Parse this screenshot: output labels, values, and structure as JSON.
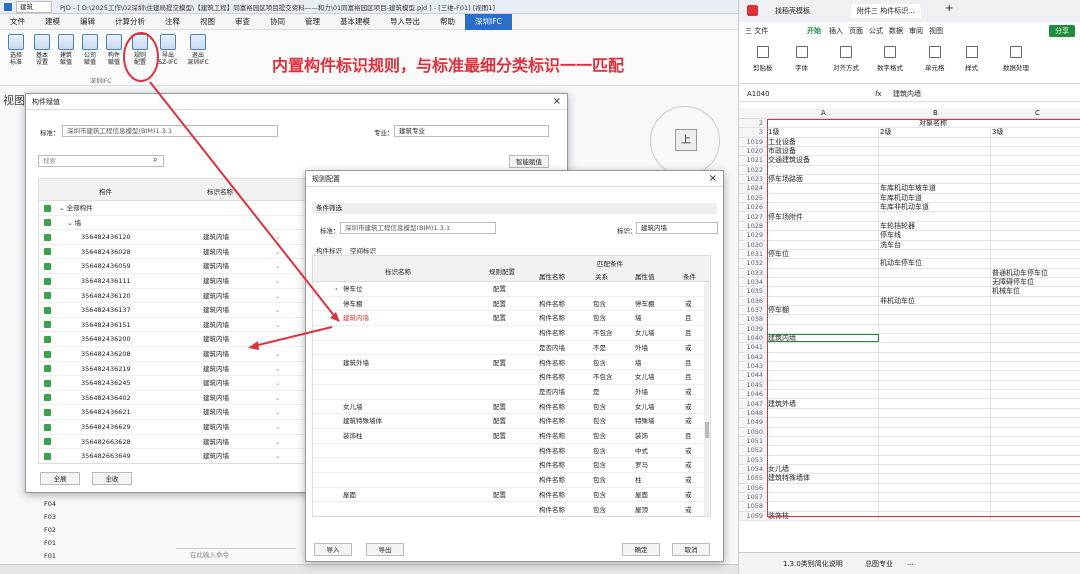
{
  "left_app": {
    "title": "PJD - [ D:\\2025工作\\02深圳\\住建局提交模型\\【建筑工程】同富裕园区项目提交资料——和力\\01同富裕园区项目-建筑模型.pjd ] - [三维-F01] [视图1]",
    "view_selector": "建筑",
    "menu": [
      "文件",
      "建模",
      "编辑",
      "计算分析",
      "注释",
      "视图",
      "审查",
      "协同",
      "管理",
      "基本建模",
      "导入导出",
      "帮助",
      "深圳IFC"
    ],
    "ribbon_buttons": [
      "选择\n标准",
      "基本\n设置",
      "建筑\n赋值",
      "公司\n赋值",
      "构件\n赋值",
      "规则\n配置",
      "导出\nSZ-IFC",
      "退出\n深圳IFC"
    ],
    "ribbon_group": "深圳IFC",
    "headline": "内置构件标识规则，与标准最细分类标识一一匹配",
    "view_label": "视图",
    "compass_label": "上",
    "floors": [
      "F04",
      "F03",
      "F02",
      "F01",
      "F01"
    ],
    "command_hint": "在此输入命令"
  },
  "dlg1": {
    "title": "构件赋值",
    "standard_label": "标准：",
    "standard_value": "深圳市建筑工程信息模型(BIM)1.3.1",
    "major_label": "专业：",
    "major_value": "建筑专业",
    "search_placeholder": "搜索",
    "smart_button": "智能赋值",
    "col_component": "构件",
    "col_identifier": "标识名称",
    "tree_all": "全部构件",
    "tree_wall": "墙",
    "rows": [
      {
        "id": "356482436120",
        "name": "建筑内墙"
      },
      {
        "id": "356482436028",
        "name": "建筑内墙"
      },
      {
        "id": "356482436059",
        "name": "建筑内墙"
      },
      {
        "id": "356482436111",
        "name": "建筑内墙"
      },
      {
        "id": "356482436120",
        "name": "建筑内墙"
      },
      {
        "id": "356482436137",
        "name": "建筑内墙"
      },
      {
        "id": "356482436151",
        "name": "建筑内墙"
      },
      {
        "id": "356482436200",
        "name": "建筑内墙"
      },
      {
        "id": "356482436208",
        "name": "建筑内墙"
      },
      {
        "id": "356482436219",
        "name": "建筑内墙"
      },
      {
        "id": "356482436245",
        "name": "建筑内墙"
      },
      {
        "id": "356482436402",
        "name": "建筑内墙"
      },
      {
        "id": "356482436621",
        "name": "建筑内墙"
      },
      {
        "id": "356482436629",
        "name": "建筑内墙"
      },
      {
        "id": "356482663628",
        "name": "建筑内墙"
      },
      {
        "id": "356482663649",
        "name": "建筑内墙"
      }
    ],
    "btn_all": "全展",
    "btn_collapse": "全收"
  },
  "dlg2": {
    "title": "规则配置",
    "filter_label": "条件筛选",
    "standard_label": "标准：",
    "standard_value": "深圳市建筑工程信息模型(BIM)1.3.1",
    "ident_label": "标识：",
    "ident_value": "建筑内墙",
    "tab1": "构件标识",
    "tab2": "空间标识",
    "headers": {
      "name": "标识名称",
      "rule": "规则配置",
      "match": "匹配条件",
      "attr": "属性名称",
      "rel": "关系",
      "val": "属性值",
      "cond": "条件"
    },
    "rows": [
      {
        "name": "停车位",
        "rule": "配置",
        "attr": "",
        "rel": "",
        "val": "",
        "cond": "",
        "expand": true
      },
      {
        "name": "停车棚",
        "rule": "配置",
        "attr": "构件名称",
        "rel": "包含",
        "val": "停车棚",
        "cond": "或"
      },
      {
        "name": "建筑内墙",
        "rule": "配置",
        "attr": "构件名称",
        "rel": "包含",
        "val": "墙",
        "cond": "且",
        "highlight": true
      },
      {
        "name": "",
        "rule": "",
        "attr": "构件名称",
        "rel": "不包含",
        "val": "女儿墙",
        "cond": "且"
      },
      {
        "name": "",
        "rule": "",
        "attr": "是否内墙",
        "rel": "不是",
        "val": "外墙",
        "cond": "或"
      },
      {
        "name": "建筑外墙",
        "rule": "配置",
        "attr": "构件名称",
        "rel": "包含",
        "val": "墙",
        "cond": "且"
      },
      {
        "name": "",
        "rule": "",
        "attr": "构件名称",
        "rel": "不包含",
        "val": "女儿墙",
        "cond": "且"
      },
      {
        "name": "",
        "rule": "",
        "attr": "是否内墙",
        "rel": "是",
        "val": "外墙",
        "cond": "或"
      },
      {
        "name": "女儿墙",
        "rule": "配置",
        "attr": "构件名称",
        "rel": "包含",
        "val": "女儿墙",
        "cond": "或"
      },
      {
        "name": "建筑特殊墙体",
        "rule": "配置",
        "attr": "构件名称",
        "rel": "包含",
        "val": "特殊墙",
        "cond": "或"
      },
      {
        "name": "装饰柱",
        "rule": "配置",
        "attr": "构件名称",
        "rel": "包含",
        "val": "装饰",
        "cond": "且"
      },
      {
        "name": "",
        "rule": "",
        "attr": "构件名称",
        "rel": "包含",
        "val": "中式",
        "cond": "或"
      },
      {
        "name": "",
        "rule": "",
        "attr": "构件名称",
        "rel": "包含",
        "val": "罗马",
        "cond": "或"
      },
      {
        "name": "",
        "rule": "",
        "attr": "构件名称",
        "rel": "包含",
        "val": "柱",
        "cond": "或"
      },
      {
        "name": "屋面",
        "rule": "配置",
        "attr": "构件名称",
        "rel": "包含",
        "val": "屋面",
        "cond": "或"
      },
      {
        "name": "",
        "rule": "",
        "attr": "构件名称",
        "rel": "包含",
        "val": "屋顶",
        "cond": "或"
      }
    ],
    "btn_import": "导入",
    "btn_export": "导出",
    "btn_ok": "确定",
    "btn_cancel": "取消"
  },
  "excel": {
    "tab1": "找稻壳模板",
    "tab2": "附件三 构件标识...",
    "menu": [
      "三 文件",
      "开始",
      "插入",
      "页面",
      "公式",
      "数据",
      "审阅",
      "视图"
    ],
    "share": "分享",
    "tools": [
      "剪贴板",
      "字体",
      "对齐方式",
      "数字格式",
      "单元格",
      "样式",
      "数据处理"
    ],
    "cell_ref": "A1040",
    "formula": "建筑内墙",
    "cols": [
      "A",
      "B",
      "C"
    ],
    "header_row2": "对象名称",
    "header_row3": [
      "1级",
      "2级",
      "3级"
    ],
    "rows": [
      {
        "n": "1019",
        "a": "工业设备",
        "b": "",
        "c": ""
      },
      {
        "n": "1020",
        "a": "市政设备",
        "b": "",
        "c": ""
      },
      {
        "n": "1021",
        "a": "交通建筑设备",
        "b": "",
        "c": ""
      },
      {
        "n": "1022",
        "a": "",
        "b": "",
        "c": ""
      },
      {
        "n": "1023",
        "a": "停车场路面",
        "b": "",
        "c": ""
      },
      {
        "n": "1024",
        "a": "",
        "b": "车库机动车坡车道",
        "c": ""
      },
      {
        "n": "1025",
        "a": "",
        "b": "车库机动车道",
        "c": ""
      },
      {
        "n": "1026",
        "a": "",
        "b": "车库非机动车道",
        "c": ""
      },
      {
        "n": "1027",
        "a": "停车场附件",
        "b": "",
        "c": ""
      },
      {
        "n": "1028",
        "a": "",
        "b": "车轮挡轮器",
        "c": ""
      },
      {
        "n": "1029",
        "a": "",
        "b": "停车线",
        "c": ""
      },
      {
        "n": "1030",
        "a": "",
        "b": "洗车台",
        "c": ""
      },
      {
        "n": "1031",
        "a": "停车位",
        "b": "",
        "c": ""
      },
      {
        "n": "1032",
        "a": "",
        "b": "机动车停车位",
        "c": ""
      },
      {
        "n": "1033",
        "a": "",
        "b": "",
        "c": "普通机动车停车位"
      },
      {
        "n": "1034",
        "a": "",
        "b": "",
        "c": "无障碍停车位"
      },
      {
        "n": "1035",
        "a": "",
        "b": "",
        "c": "机械车位"
      },
      {
        "n": "1036",
        "a": "",
        "b": "非机动车位",
        "c": ""
      },
      {
        "n": "1037",
        "a": "停车棚",
        "b": "",
        "c": ""
      },
      {
        "n": "1038",
        "a": "",
        "b": "",
        "c": ""
      },
      {
        "n": "1039",
        "a": "",
        "b": "",
        "c": ""
      },
      {
        "n": "1040",
        "a": "建筑内墙",
        "b": "",
        "c": "",
        "selected": true
      },
      {
        "n": "1041",
        "a": "",
        "b": "",
        "c": ""
      },
      {
        "n": "1042",
        "a": "",
        "b": "",
        "c": ""
      },
      {
        "n": "1043",
        "a": "",
        "b": "",
        "c": ""
      },
      {
        "n": "1044",
        "a": "",
        "b": "",
        "c": ""
      },
      {
        "n": "1045",
        "a": "",
        "b": "",
        "c": ""
      },
      {
        "n": "1046",
        "a": "",
        "b": "",
        "c": ""
      },
      {
        "n": "1047",
        "a": "建筑外墙",
        "b": "",
        "c": ""
      },
      {
        "n": "1048",
        "a": "",
        "b": "",
        "c": ""
      },
      {
        "n": "1049",
        "a": "",
        "b": "",
        "c": ""
      },
      {
        "n": "1050",
        "a": "",
        "b": "",
        "c": ""
      },
      {
        "n": "1051",
        "a": "",
        "b": "",
        "c": ""
      },
      {
        "n": "1052",
        "a": "",
        "b": "",
        "c": ""
      },
      {
        "n": "1053",
        "a": "",
        "b": "",
        "c": ""
      },
      {
        "n": "1054",
        "a": "女儿墙",
        "b": "",
        "c": ""
      },
      {
        "n": "1055",
        "a": "建筑特殊墙体",
        "b": "",
        "c": ""
      },
      {
        "n": "1056",
        "a": "",
        "b": "",
        "c": ""
      },
      {
        "n": "1057",
        "a": "",
        "b": "",
        "c": ""
      },
      {
        "n": "1058",
        "a": "",
        "b": "",
        "c": ""
      },
      {
        "n": "1059",
        "a": "装饰柱",
        "b": "",
        "c": ""
      }
    ],
    "sheet_tabs": [
      "1.3.0类别简化说明",
      "总图专业",
      "..."
    ]
  },
  "colors": {
    "accent": "#2b6ec9",
    "highlight_red": "#e0303c",
    "check_green": "#3aa34a",
    "excel_green": "#1e8c3a"
  }
}
